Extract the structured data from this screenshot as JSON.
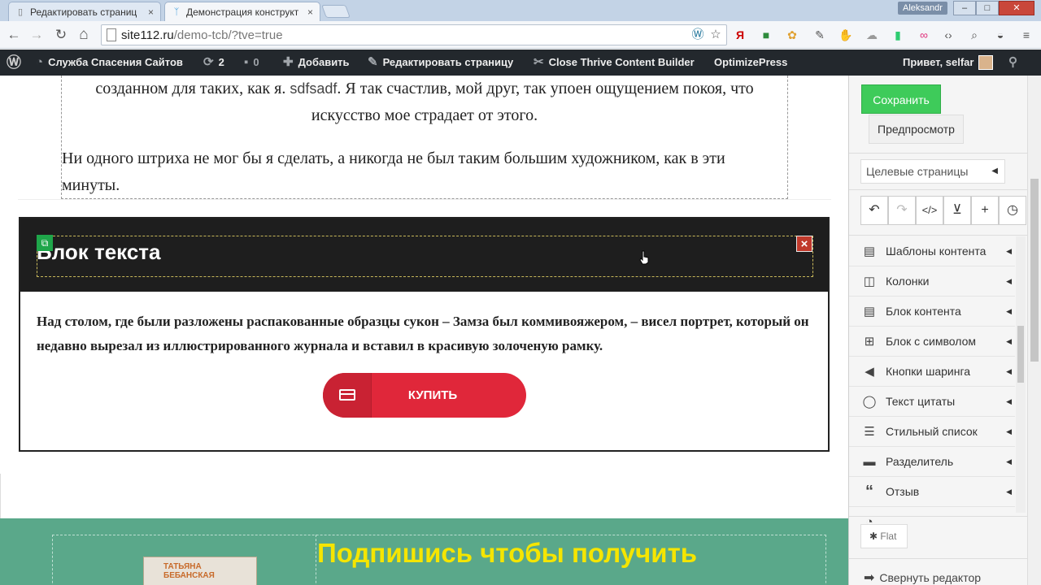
{
  "browser": {
    "tabs": [
      {
        "label": "Редактировать страниц",
        "close": "×"
      },
      {
        "label": "Демонстрация конструкт",
        "close": "×"
      }
    ],
    "user": "Aleksandr",
    "window_buttons": {
      "minimize": "–",
      "maximize": "□",
      "close": "✕"
    },
    "nav": {
      "back": "←",
      "forward": "→",
      "reload": "↻",
      "home": "⌂"
    },
    "url_host": "site112.ru",
    "url_path": "/demo-tcb/?tve=true"
  },
  "adminbar": {
    "site_name": "Служба Спасения Сайтов",
    "updates_count": "2",
    "comments_count": "0",
    "add_new": "Добавить",
    "edit_page": "Редактировать страницу",
    "close_builder": "Close Thrive Content Builder",
    "optimizepress": "OptimizePress",
    "greeting": "Привет, selfar"
  },
  "content": {
    "paragraph1_a": "созданном для таких, как я. ",
    "paragraph1_b": "sdfsadf",
    "paragraph1_c": ". Я так счастлив, мой друг, так упоен ощущением покоя, что искусство мое страдает от этого.",
    "paragraph2": "Ни одного штриха не мог бы я сделать, а никогда не был таким большим художником, как в эти минуты.",
    "box_title": "Блок текста",
    "box_text": "Над столом, где были разложены распакованные образцы сукон – Замза был коммивояжером, – висел портрет, который он недавно вырезал из иллюстрированного журнала и вставил в красивую золоченую рамку.",
    "buy_label": "КУПИТЬ",
    "subscribe_title": "Подпишись чтобы получить",
    "book_text": "ТАТЬЯНА\nБЕБАНСКАЯ"
  },
  "sidebar": {
    "save": "Сохранить",
    "preview": "Предпросмотр",
    "landing_pages": "Целевые страницы",
    "menu": [
      {
        "label": "Шаблоны контента",
        "icon": "page-icon"
      },
      {
        "label": "Колонки",
        "icon": "columns-icon"
      },
      {
        "label": "Блок контента",
        "icon": "content-block-icon"
      },
      {
        "label": "Блок с символом",
        "icon": "icon-block-icon"
      },
      {
        "label": "Кнопки шаринга",
        "icon": "share-icon"
      },
      {
        "label": "Текст цитаты",
        "icon": "quote-bubble-icon"
      },
      {
        "label": "Стильный список",
        "icon": "list-icon"
      },
      {
        "label": "Разделитель",
        "icon": "divider-icon"
      },
      {
        "label": "Отзыв",
        "icon": "testimonial-quote-icon"
      }
    ],
    "flat": "Flat",
    "collapse": "Свернуть редактор"
  },
  "colors": {
    "save_green": "#3ecb5a",
    "buy_red": "#e0273a",
    "section_green": "#5aa88a",
    "subscribe_yellow": "#f5e500",
    "adminbar": "#23282d"
  }
}
